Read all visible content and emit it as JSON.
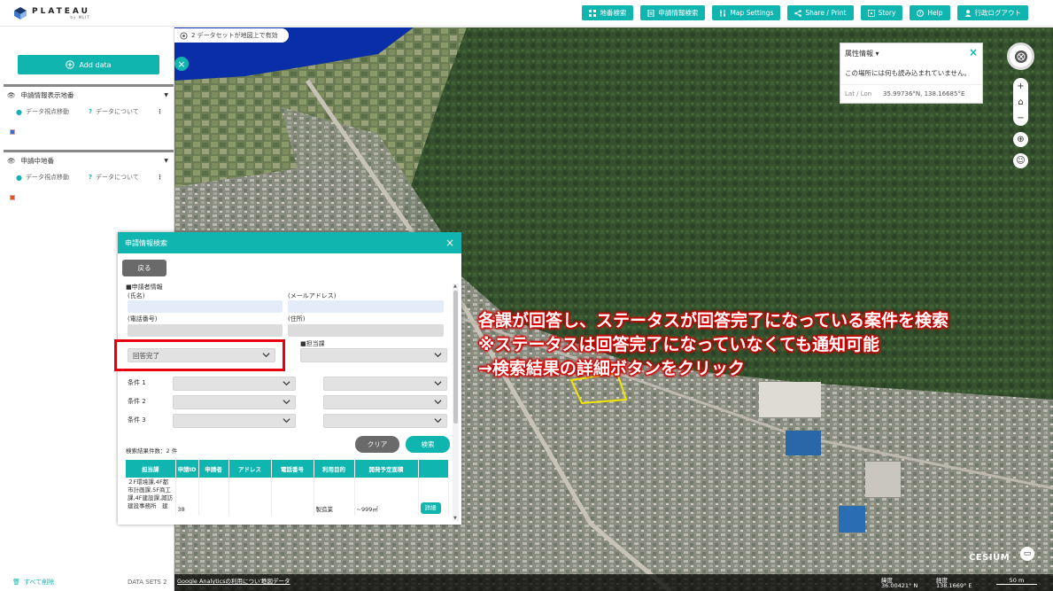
{
  "app": {
    "logo_text": "PLATEAU",
    "logo_sub": "by MLIT"
  },
  "topbar": {
    "buttons": [
      {
        "label": "地番検索",
        "icon": "grid-icon"
      },
      {
        "label": "申請情報検索",
        "icon": "document-icon"
      },
      {
        "label": "Map Settings",
        "icon": "sliders-icon"
      },
      {
        "label": "Share / Print",
        "icon": "share-icon"
      },
      {
        "label": "Story",
        "icon": "story-icon"
      },
      {
        "label": "Help",
        "icon": "help-icon"
      },
      {
        "label": "行政ログアウト",
        "icon": "user-icon"
      }
    ]
  },
  "dataset_badge": "2 データセットが地図上で有効",
  "left_panel": {
    "add_data": "Add data",
    "layers": [
      {
        "title": "申請情報表示地番",
        "move": "データ視点移動",
        "about": "データについて",
        "swatch": "#3a6fd8"
      },
      {
        "title": "申請中地番",
        "move": "データ視点移動",
        "about": "データについて",
        "swatch": "#e8541a"
      }
    ],
    "remove_all": "すべて削除",
    "datasets": "DATA SETS 2"
  },
  "attribute_box": {
    "title": "属性情報",
    "message": "この場所には何も読み込まれていません。",
    "latlon_label": "Lat / Lon",
    "latlon_value": "35.99736°N, 138.16685°E"
  },
  "map_footer": {
    "ga": "Google Analyticsの利用について",
    "data": "地図データ",
    "lat_label": "緯度",
    "lat_value": "36.00421° N",
    "lon_label": "経度",
    "lon_value": "138.1669° E",
    "scale": "50 m"
  },
  "cesium": "CESIUM",
  "annotation": {
    "line1": "各課が回答し、ステータスが回答完了になっている案件を検索",
    "line2": "※ステータスは回答完了になっていなくても通知可能",
    "line3": "→検索結果の詳細ボタンをクリック"
  },
  "dialog": {
    "title": "申請情報検索",
    "back": "戻る",
    "applicant_section": "■申請者情報",
    "name_label": "(氏名)",
    "email_label": "(メールアドレス)",
    "phone_label": "(電話番号)",
    "address_label": "(住所)",
    "status_value": "回答完了",
    "department_label": "■担当課",
    "cond1": "条件 1",
    "cond2": "条件 2",
    "cond3": "条件 3",
    "clear": "クリア",
    "search": "検索",
    "result_count": "検索結果件数：2 件",
    "table": {
      "headers": [
        "担当課",
        "申請ID",
        "申請者",
        "アドレス",
        "電話番号",
        "利用目的",
        "開発予定面積",
        ""
      ],
      "row": {
        "department": "２F環境課,4F都市計画課,5F商工課,4F建設課,諏訪建設事務所　建",
        "id": "38",
        "purpose": "製造業",
        "area": "~999㎡",
        "detail": "詳細"
      }
    }
  }
}
